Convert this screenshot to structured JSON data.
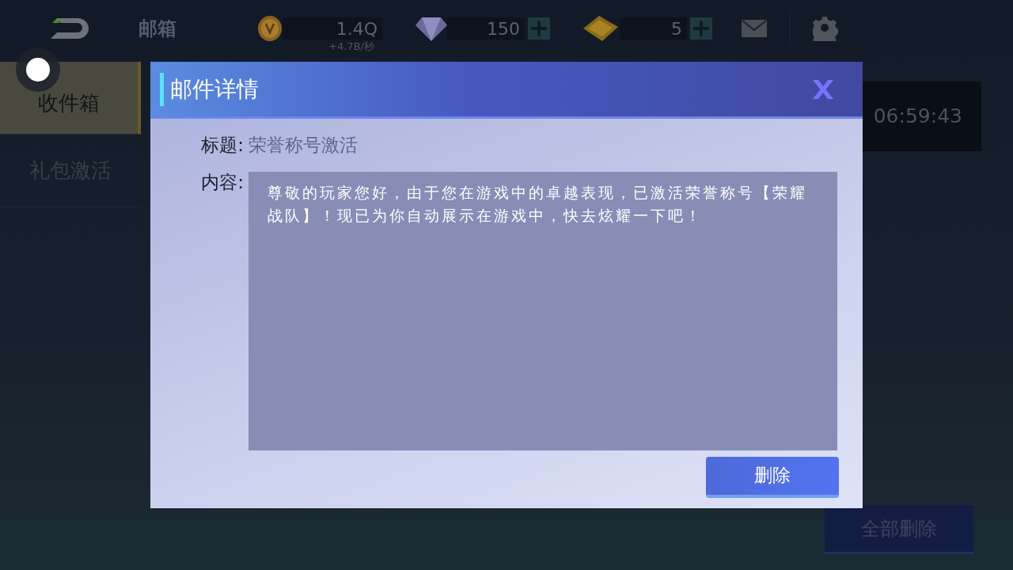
{
  "header": {
    "title": "邮箱",
    "currencies": [
      {
        "kind": "coin",
        "value": "1.4Q",
        "rate": "+4.7B/秒",
        "has_add": false
      },
      {
        "kind": "diamond",
        "value": "150",
        "has_add": true
      },
      {
        "kind": "ticket",
        "value": "5",
        "has_add": true
      }
    ]
  },
  "sidebar": {
    "items": [
      {
        "label": "收件箱",
        "selected": true
      },
      {
        "label": "礼包激活",
        "selected": false
      }
    ]
  },
  "timer": "06:59:43",
  "delete_all_button": "全部删除",
  "dialog": {
    "title": "邮件详情",
    "subject_label": "标题:",
    "subject": "荣誉称号激活",
    "content_label": "内容:",
    "content": "尊敬的玩家您好，由于您在游戏中的卓越表现，已激活荣誉称号【荣耀战队】！现已为你自动展示在游戏中，快去炫耀一下吧！",
    "delete_button": "删除"
  }
}
